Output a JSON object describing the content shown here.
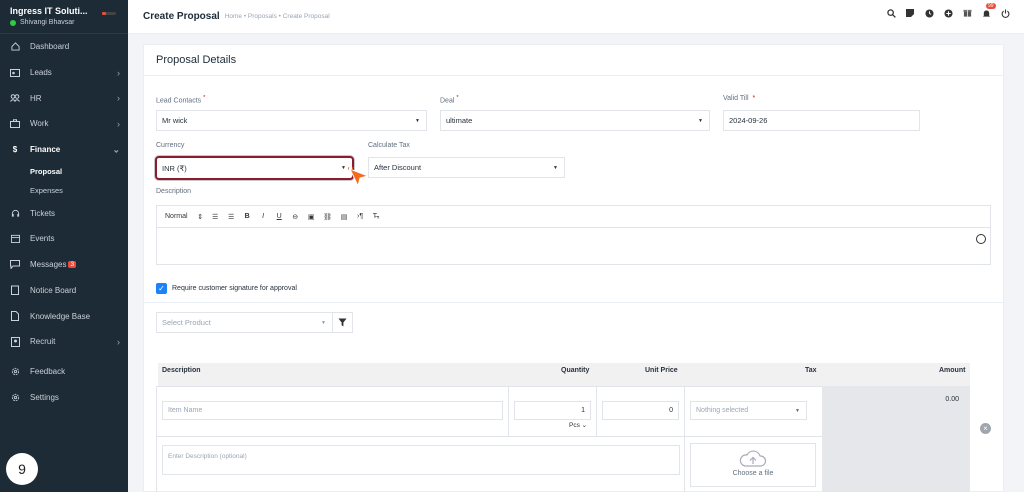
{
  "sidebar": {
    "company": "Ingress IT Soluti...",
    "user": "Shivangi Bhavsar",
    "items": [
      {
        "label": "Dashboard",
        "icon": "house-icon",
        "chevron": false
      },
      {
        "label": "Leads",
        "icon": "id-card-icon",
        "chevron": true
      },
      {
        "label": "HR",
        "icon": "people-icon",
        "chevron": true
      },
      {
        "label": "Work",
        "icon": "briefcase-icon",
        "chevron": true
      },
      {
        "label": "Finance",
        "icon": "dollar-icon",
        "chevron": true,
        "expanded": true
      },
      {
        "label": "Tickets",
        "icon": "headset-icon",
        "chevron": false
      },
      {
        "label": "Events",
        "icon": "calendar-icon",
        "chevron": false
      },
      {
        "label": "Messages",
        "icon": "chat-icon",
        "chevron": false,
        "badge": "3"
      },
      {
        "label": "Notice Board",
        "icon": "clipboard-icon",
        "chevron": false
      },
      {
        "label": "Knowledge Base",
        "icon": "file-icon",
        "chevron": false
      },
      {
        "label": "Recruit",
        "icon": "person-badge-icon",
        "chevron": true
      },
      {
        "label": "Feedback",
        "icon": "gear-icon",
        "chevron": false
      },
      {
        "label": "Settings",
        "icon": "gear-icon",
        "chevron": false
      }
    ],
    "finance_sub": [
      "Proposal",
      "Expenses"
    ],
    "step_number": "9"
  },
  "header": {
    "title": "Create Proposal",
    "breadcrumb": "Home • Proposals • Create Proposal",
    "notification_count": "99"
  },
  "card": {
    "title": "Proposal Details",
    "lead_contacts_label": "Lead Contacts",
    "lead_contacts_value": "Mr wick",
    "deal_label": "Deal",
    "deal_value": "ultimate",
    "valid_till_label": "Valid Till",
    "valid_till_value": "2024-09-26",
    "currency_label": "Currency",
    "currency_value": "INR (₹)",
    "calculate_tax_label": "Calculate Tax",
    "calculate_tax_value": "After Discount",
    "description_label": "Description",
    "editor": {
      "format": "Normal"
    },
    "signature_label": "Require customer signature for approval",
    "select_product_placeholder": "Select Product"
  },
  "table": {
    "headers": {
      "description": "Description",
      "quantity": "Quantity",
      "unit_price": "Unit Price",
      "tax": "Tax",
      "amount": "Amount"
    },
    "row": {
      "item_name_placeholder": "Item Name",
      "quantity": "1",
      "unit": "Pcs",
      "unit_price": "0",
      "tax": "Nothing selected",
      "amount": "0.00",
      "description_placeholder": "Enter Description (optional)",
      "upload_label": "Choose a file"
    }
  }
}
